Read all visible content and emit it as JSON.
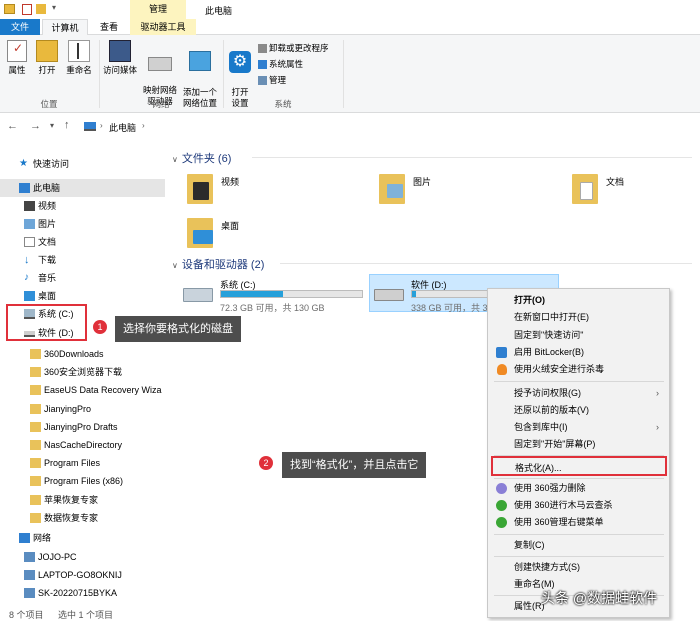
{
  "titlebar": {
    "window_title": "此电脑",
    "context_tab": "管理"
  },
  "ribbon_tabs": [
    {
      "label": "文件"
    },
    {
      "label": "计算机"
    },
    {
      "label": "查看"
    },
    {
      "label": "驱动器工具"
    }
  ],
  "ribbon": {
    "location": {
      "group": "位置",
      "properties": "属性",
      "open": "打开",
      "rename": "重命名"
    },
    "network": {
      "group": "网络",
      "access_media": "访问媒体",
      "map_drive": "映射网络\n驱动器",
      "add_location": "添加一个\n网络位置"
    },
    "system": {
      "group": "系统",
      "open_settings": "打开\n设置",
      "uninstall": "卸载或更改程序",
      "system_props": "系统属性",
      "manage": "管理"
    }
  },
  "address": {
    "path": "此电脑"
  },
  "nav": {
    "quick_access": "快速访问",
    "this_pc": "此电脑",
    "items": [
      "视频",
      "图片",
      "文档",
      "下载",
      "音乐",
      "桌面"
    ],
    "drive_c": "系统 (C:)",
    "drive_d": "软件 (D:)",
    "folders": [
      "360Downloads",
      "360安全浏览器下载",
      "EaseUS Data Recovery Wiza",
      "JianyingPro",
      "JianyingPro Drafts",
      "NasCacheDirectory",
      "Program Files",
      "Program Files (x86)",
      "苹果恢复专家",
      "数据恢复专家"
    ],
    "network": "网络",
    "computers": [
      "JOJO-PC",
      "LAPTOP-GO8OKNIJ",
      "SK-20220715BYKA"
    ]
  },
  "main": {
    "folders_header": "文件夹 (6)",
    "folders": [
      "视频",
      "图片",
      "文档",
      "桌面"
    ],
    "drives_header": "设备和驱动器 (2)",
    "drive_c": {
      "name": "系统 (C:)",
      "free": "72.3 GB 可用，共 130 GB",
      "used_fraction": 0.44
    },
    "drive_d": {
      "name": "软件 (D:)",
      "free": "338 GB 可用，共 3",
      "used_fraction": 0.03
    }
  },
  "context_menu": {
    "items": [
      "打开(O)",
      "在新窗口中打开(E)",
      "固定到\"快速访问\"",
      "启用 BitLocker(B)",
      "使用火绒安全进行杀毒",
      "授予访问权限(G)",
      "还原以前的版本(V)",
      "包含到库中(I)",
      "固定到\"开始\"屏幕(P)",
      "格式化(A)...",
      "使用 360强力删除",
      "使用 360进行木马云查杀",
      "使用 360管理右键菜单",
      "复制(C)",
      "创建快捷方式(S)",
      "重命名(M)",
      "属性(R)"
    ]
  },
  "annotations": {
    "step1_num": "1",
    "step1_text": "选择你要格式化的磁盘",
    "step2_num": "2",
    "step2_text": "找到“格式化”，并且点击它"
  },
  "status": {
    "count": "8 个项目",
    "selected": "选中 1 个项目"
  },
  "watermark": "头条 @数据蛙软件",
  "colors": {
    "accent": "#1979ca",
    "highlight": "#cce8ff",
    "manage_tab": "#fdf4bf",
    "annotation_red": "#e0303a"
  }
}
